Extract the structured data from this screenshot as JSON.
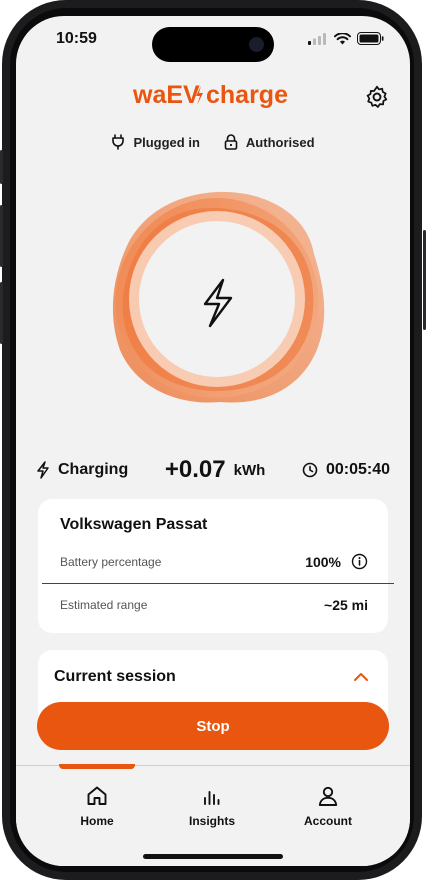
{
  "status_bar": {
    "time": "10:59",
    "icons": [
      "cellular-signal-icon",
      "wifi-icon",
      "battery-icon"
    ]
  },
  "header": {
    "logo_text": "waEV",
    "logo_text_2": "charge",
    "settings_icon": "gear-icon"
  },
  "status_chips": [
    {
      "icon": "plug-icon",
      "label": "Plugged in"
    },
    {
      "icon": "lock-icon",
      "label": "Authorised"
    }
  ],
  "orb": {
    "icon": "lightning-bolt-icon"
  },
  "stats": {
    "state": "Charging",
    "energy_value": "+0.07",
    "energy_unit": "kWh",
    "duration": "00:05:40"
  },
  "vehicle": {
    "name": "Volkswagen Passat",
    "battery_label": "Battery percentage",
    "battery_value": "100%",
    "range_label": "Estimated range",
    "range_value": "~25 mi"
  },
  "session": {
    "title": "Current session",
    "expanded": true
  },
  "actions": {
    "stop_label": "Stop"
  },
  "nav": {
    "items": [
      {
        "label": "Home",
        "icon": "home-icon",
        "active": true
      },
      {
        "label": "Insights",
        "icon": "bar-chart-icon",
        "active": false
      },
      {
        "label": "Account",
        "icon": "user-icon",
        "active": false
      }
    ]
  },
  "colors": {
    "brand": "#e8560f",
    "background": "#f2f2f2",
    "card": "#ffffff",
    "text": "#111111"
  }
}
